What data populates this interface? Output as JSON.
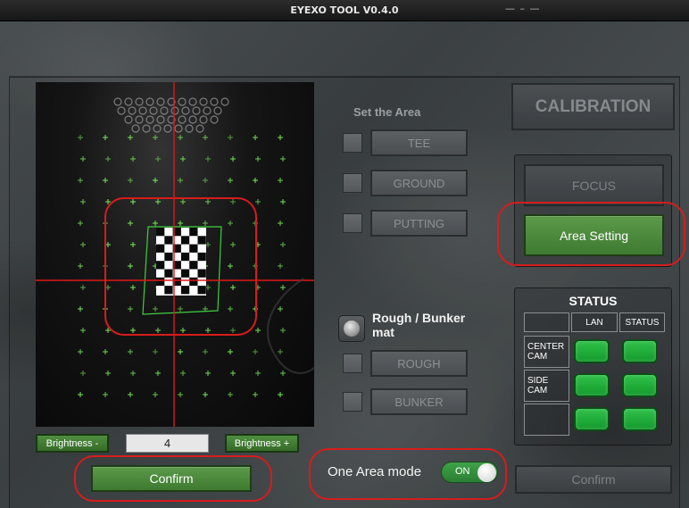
{
  "window": {
    "title": "EYEXO TOOL V0.4.0",
    "controls": "— – —"
  },
  "camera": {
    "brightness_minus": "Brightness -",
    "brightness_value": "4",
    "brightness_plus": "Brightness +",
    "confirm": "Confirm"
  },
  "area": {
    "title": "Set the Area",
    "tee": "TEE",
    "ground": "GROUND",
    "putting": "PUTTING",
    "rough_bunker_label": "Rough / Bunker mat",
    "rough": "ROUGH",
    "bunker": "BUNKER"
  },
  "mode": {
    "label": "One Area mode",
    "toggle_state": "ON"
  },
  "right": {
    "calibration": "CALIBRATION",
    "focus": "FOCUS",
    "area_setting": "Area Setting",
    "confirm": "Confirm"
  },
  "status": {
    "title": "STATUS",
    "headers": [
      "LAN",
      "STATUS"
    ],
    "rows": [
      {
        "label": "CENTER CAM"
      },
      {
        "label": "SIDE CAM"
      },
      {
        "label": ""
      }
    ]
  },
  "colors": {
    "accent_green": "#4a8a3b",
    "led_green": "#22b23c",
    "highlight_red": "#d71c1c",
    "crosshair_red": "#e01818",
    "marker_green": "#7dff5a"
  }
}
